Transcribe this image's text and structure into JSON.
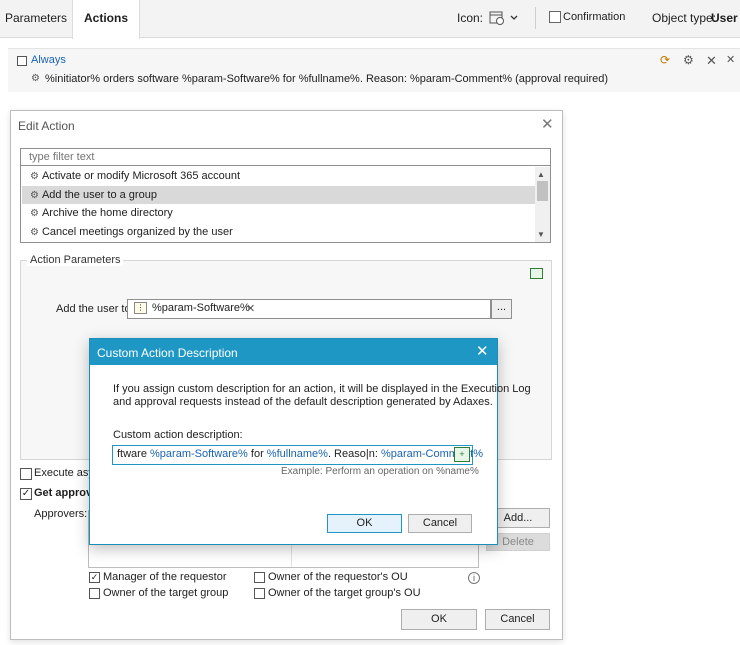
{
  "toolbar": {
    "tabs": [
      {
        "label": "Parameters"
      },
      {
        "label": "Actions"
      }
    ],
    "icon_label": "Icon:",
    "confirmation_label": "Confirmation",
    "object_type_label": "Object type:",
    "object_type_value": "User"
  },
  "condition": {
    "label": "Always",
    "action_text": "%initiator% orders software %param-Software% for %fullname%. Reason: %param-Comment%  (approval required)",
    "row_icons": [
      "set-condition-icon",
      "settings-icon",
      "delete-icon",
      "remove-condition-icon"
    ]
  },
  "edit_action": {
    "title": "Edit Action",
    "filter_placeholder": "type filter text",
    "actions": [
      {
        "label": "Activate or modify Microsoft 365 account",
        "selected": false
      },
      {
        "label": "Add the user to a group",
        "selected": true
      },
      {
        "label": "Archive the home directory",
        "selected": false
      },
      {
        "label": "Cancel meetings organized by the user",
        "selected": false
      }
    ],
    "params_legend": "Action Parameters",
    "add_user_label": "Add the user to",
    "group_value": "%param-Software%",
    "browse_label": "...",
    "execute_async_label": "Execute asy",
    "get_approval_label": "Get approv",
    "approvers_label": "Approvers:",
    "add_button": "Add...",
    "delete_button": "Delete",
    "approver_options": [
      {
        "label": "Manager of the requestor",
        "checked": true
      },
      {
        "label": "Owner of the requestor's OU",
        "checked": false
      },
      {
        "label": "Owner of the target group",
        "checked": false
      },
      {
        "label": "Owner of the target group's OU",
        "checked": false
      }
    ],
    "ok_button": "OK",
    "cancel_button": "Cancel"
  },
  "custom_description": {
    "title": "Custom Action Description",
    "desc_line1": "If you assign custom description for an action, it will be displayed in the Execution Log",
    "desc_line2": "and approval requests instead of the default description generated by Adaxes.",
    "field_label": "Custom action description:",
    "input_parts": [
      {
        "text": "ftware ",
        "token": false
      },
      {
        "text": "%param-Software%",
        "token": true
      },
      {
        "text": " for ",
        "token": false
      },
      {
        "text": "%fullname%",
        "token": true
      },
      {
        "text": ". Reaso|n: ",
        "token": false
      },
      {
        "text": "%param-Comment%",
        "token": true
      }
    ],
    "example": "Example: Perform an operation on %name%",
    "ok_button": "OK",
    "cancel_button": "Cancel"
  }
}
